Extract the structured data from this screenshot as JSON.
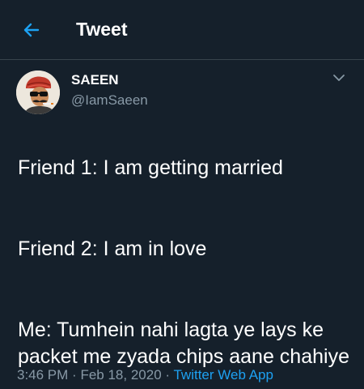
{
  "header": {
    "title": "Tweet",
    "back_icon": "arrow-left-icon",
    "accent_color": "#1da1f2"
  },
  "tweet": {
    "author": {
      "display_name": "SAEEN",
      "handle": "@IamSaeen",
      "avatar_icon": "avatar-caricature"
    },
    "menu_icon": "chevron-down-icon",
    "text_paragraphs": [
      "Friend 1: I am getting married",
      "Friend 2: I am in love",
      "Me: Tumhein nahi lagta ye lays ke packet me zyada chips aane chahiye"
    ],
    "time": "3:46 PM",
    "date": "Feb 18, 2020",
    "separator": "·",
    "source": "Twitter Web App"
  },
  "colors": {
    "background": "#15202b",
    "text": "#ffffff",
    "muted": "#8899a6",
    "divider": "#38444d"
  }
}
